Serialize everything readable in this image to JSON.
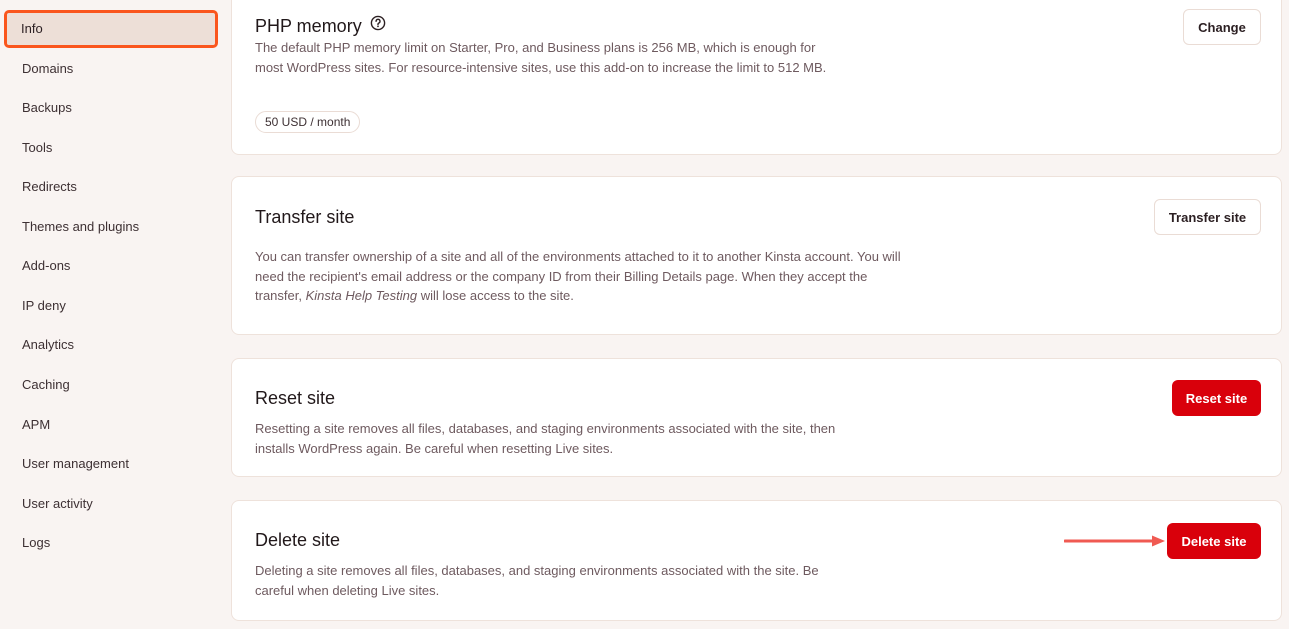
{
  "sidebar": {
    "items": [
      {
        "label": "Info",
        "active": true
      },
      {
        "label": "Domains"
      },
      {
        "label": "Backups"
      },
      {
        "label": "Tools"
      },
      {
        "label": "Redirects"
      },
      {
        "label": "Themes and plugins"
      },
      {
        "label": "Add-ons"
      },
      {
        "label": "IP deny"
      },
      {
        "label": "Analytics"
      },
      {
        "label": "Caching"
      },
      {
        "label": "APM"
      },
      {
        "label": "User management"
      },
      {
        "label": "User activity"
      },
      {
        "label": "Logs"
      }
    ]
  },
  "cards": {
    "php_memory": {
      "title": "PHP memory",
      "help_icon": "question-circle-icon",
      "description": "The default PHP memory limit on Starter, Pro, and Business plans is 256 MB, which is enough for most WordPress sites. For resource-intensive sites, use this add-on to increase the limit to 512 MB.",
      "price": "50 USD / month",
      "button": "Change"
    },
    "transfer_site": {
      "title": "Transfer site",
      "description_before": "You can transfer ownership of a site and all of the environments attached to it to another Kinsta account. You will need the recipient's email address or the company ID from their Billing Details page. When they accept the transfer, ",
      "description_company": "Kinsta Help Testing",
      "description_after": " will lose access to the site.",
      "button": "Transfer site"
    },
    "reset_site": {
      "title": "Reset site",
      "description": "Resetting a site removes all files, databases, and staging environments associated with the site, then installs WordPress again. Be careful when resetting Live sites.",
      "button": "Reset site"
    },
    "delete_site": {
      "title": "Delete site",
      "description": "Deleting a site removes all files, databases, and staging environments associated with the site. Be careful when deleting Live sites.",
      "button": "Delete site"
    }
  },
  "colors": {
    "highlight": "#fa561d",
    "danger": "#d9000b",
    "annotation_arrow": "#f05a52",
    "background": "#f9f4f2"
  }
}
